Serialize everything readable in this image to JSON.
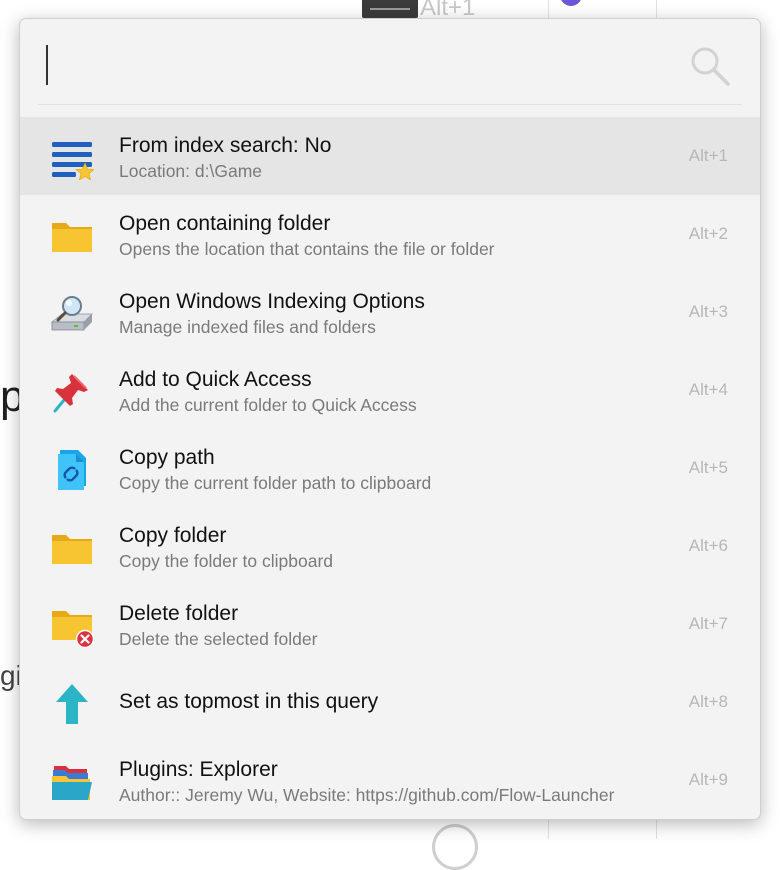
{
  "background": {
    "tab_hint": "Alt+1",
    "peek_text_1": "p",
    "peek_text_2": "gi"
  },
  "search": {
    "query": "",
    "placeholder": ""
  },
  "results": [
    {
      "title": "From index search: No",
      "subtitle": "Location: d:\\Game",
      "hotkey": "Alt+1",
      "icon": "index-list-star-icon",
      "selected": true
    },
    {
      "title": "Open containing folder",
      "subtitle": "Opens the location that contains the file or folder",
      "hotkey": "Alt+2",
      "icon": "folder-icon"
    },
    {
      "title": "Open Windows Indexing Options",
      "subtitle": "Manage indexed files and folders",
      "hotkey": "Alt+3",
      "icon": "indexing-drive-icon"
    },
    {
      "title": "Add to Quick Access",
      "subtitle": "Add the current folder to Quick Access",
      "hotkey": "Alt+4",
      "icon": "pin-icon"
    },
    {
      "title": "Copy path",
      "subtitle": "Copy the current folder path to clipboard",
      "hotkey": "Alt+5",
      "icon": "copy-path-icon"
    },
    {
      "title": "Copy folder",
      "subtitle": "Copy the folder to clipboard",
      "hotkey": "Alt+6",
      "icon": "folder-icon"
    },
    {
      "title": "Delete folder",
      "subtitle": "Delete the selected folder",
      "hotkey": "Alt+7",
      "icon": "delete-folder-icon"
    },
    {
      "title": "Set as topmost in this query",
      "subtitle": "",
      "hotkey": "Alt+8",
      "icon": "arrow-up-icon"
    },
    {
      "title": "Plugins: Explorer",
      "subtitle": "Author:: Jeremy Wu, Website: https://github.com/Flow-Launcher",
      "hotkey": "Alt+9",
      "icon": "explorer-folders-icon"
    }
  ],
  "colors": {
    "accent_blue": "#1f5fbf",
    "folder_yellow": "#f7c531",
    "pin_red": "#d8323c",
    "arrow_teal": "#2bb5c7",
    "selected_row": "#e5e5e5"
  }
}
